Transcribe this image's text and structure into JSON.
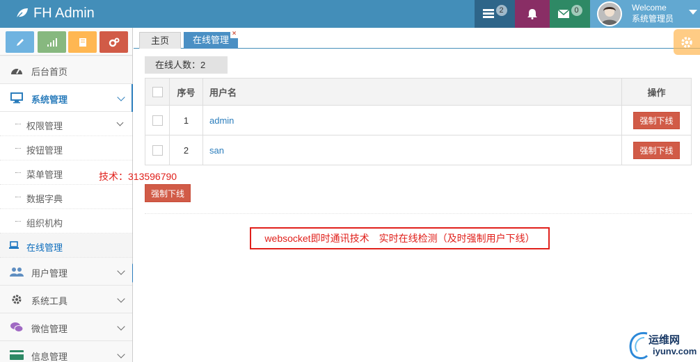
{
  "app": {
    "brand": "FH Admin"
  },
  "header": {
    "tasks_count": "2",
    "mail_count": "0",
    "welcome": "Welcome",
    "user_role": "系统管理员"
  },
  "sidebar": {
    "shortcut_colors": [
      "#6fb3e0",
      "#87b87f",
      "#ffb752",
      "#d15b47"
    ],
    "items": [
      {
        "label": "后台首页",
        "icon": "dashboard-icon"
      },
      {
        "label": "系统管理",
        "icon": "desktop-icon",
        "open": true
      },
      {
        "label": "用户管理",
        "icon": "users-icon"
      },
      {
        "label": "系统工具",
        "icon": "cog-icon"
      },
      {
        "label": "微信管理",
        "icon": "comments-icon"
      },
      {
        "label": "信息管理",
        "icon": "credit-card-icon"
      }
    ],
    "subitems": [
      {
        "label": "权限管理"
      },
      {
        "label": "按钮管理"
      },
      {
        "label": "菜单管理"
      },
      {
        "label": "数据字典"
      },
      {
        "label": "组织机构"
      },
      {
        "label": "在线管理",
        "active": true
      }
    ]
  },
  "tabs": [
    {
      "label": "主页"
    },
    {
      "label": "在线管理",
      "active": true,
      "close": "×"
    }
  ],
  "main": {
    "online_count_label": "在线人数：2",
    "table": {
      "headers": {
        "index": "序号",
        "username": "用户名",
        "action": "操作"
      },
      "rows": [
        {
          "index": "1",
          "username": "admin",
          "action": "强制下线"
        },
        {
          "index": "2",
          "username": "san",
          "action": "强制下线"
        }
      ]
    },
    "bulk_action": "强制下线",
    "tech_label": "技术：313596790",
    "annotation": "websocket即时通讯技术　实时在线检测（及时强制用户下线）"
  },
  "watermark": {
    "cn": "运维网",
    "en": "iyunv.com"
  },
  "colors": {
    "navbar": "#438eb9",
    "accent": "#2b7dbc",
    "danger": "#d15b47",
    "annotation_red": "#e0201b"
  }
}
